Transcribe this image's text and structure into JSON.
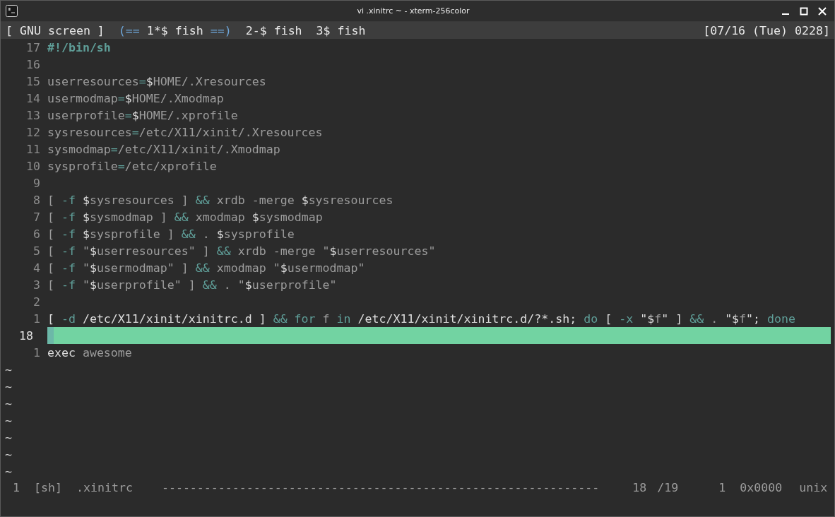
{
  "window": {
    "title": "vi .xinitrc ~ - xterm-256color"
  },
  "screen_bar": {
    "label": "[ GNU screen ]",
    "active_left": "(==",
    "active_right": "==)",
    "clock": "[07/16 (Tue) 0228]",
    "windows": [
      {
        "label": "1*$ fish",
        "selected": true
      },
      {
        "label": "2-$ fish",
        "selected": false
      },
      {
        "label": "3$ fish",
        "selected": false
      }
    ]
  },
  "editor": {
    "lines": [
      {
        "kind": "code",
        "number": "17",
        "current": false,
        "segments": [
          {
            "kind": "shebang",
            "text": "#!/bin/sh"
          }
        ]
      },
      {
        "kind": "code",
        "number": "16",
        "current": false
      },
      {
        "kind": "code",
        "number": "15",
        "current": false,
        "segments": [
          {
            "kind": "text",
            "text": "userresources"
          },
          {
            "kind": "op",
            "text": "="
          },
          {
            "kind": "bright",
            "text": "$"
          },
          {
            "kind": "text",
            "text": "HOME/.Xresources"
          }
        ]
      },
      {
        "kind": "code",
        "number": "14",
        "current": false,
        "segments": [
          {
            "kind": "text",
            "text": "usermodmap"
          },
          {
            "kind": "op",
            "text": "="
          },
          {
            "kind": "bright",
            "text": "$"
          },
          {
            "kind": "text",
            "text": "HOME/.Xmodmap"
          }
        ]
      },
      {
        "kind": "code",
        "number": "13",
        "current": false,
        "segments": [
          {
            "kind": "text",
            "text": "userprofile"
          },
          {
            "kind": "op",
            "text": "="
          },
          {
            "kind": "bright",
            "text": "$"
          },
          {
            "kind": "text",
            "text": "HOME/.xprofile"
          }
        ]
      },
      {
        "kind": "code",
        "number": "12",
        "current": false,
        "segments": [
          {
            "kind": "text",
            "text": "sysresources"
          },
          {
            "kind": "op",
            "text": "="
          },
          {
            "kind": "text",
            "text": "/etc/X11/xinit/.Xresources"
          }
        ]
      },
      {
        "kind": "code",
        "number": "11",
        "current": false,
        "segments": [
          {
            "kind": "text",
            "text": "sysmodmap"
          },
          {
            "kind": "op",
            "text": "="
          },
          {
            "kind": "text",
            "text": "/etc/X11/xinit/.Xmodmap"
          }
        ]
      },
      {
        "kind": "code",
        "number": "10",
        "current": false,
        "segments": [
          {
            "kind": "text",
            "text": "sysprofile"
          },
          {
            "kind": "op",
            "text": "="
          },
          {
            "kind": "text",
            "text": "/etc/xprofile"
          }
        ]
      },
      {
        "kind": "code",
        "number": "9",
        "current": false
      },
      {
        "kind": "code",
        "number": "8",
        "current": false,
        "segments": [
          {
            "kind": "text",
            "text": "[ "
          },
          {
            "kind": "op",
            "text": "-f "
          },
          {
            "kind": "bright",
            "text": "$"
          },
          {
            "kind": "text",
            "text": "sysresources ] "
          },
          {
            "kind": "op",
            "text": "&&"
          },
          {
            "kind": "text",
            "text": " xrdb -merge "
          },
          {
            "kind": "bright",
            "text": "$"
          },
          {
            "kind": "text",
            "text": "sysresources"
          }
        ]
      },
      {
        "kind": "code",
        "number": "7",
        "current": false,
        "segments": [
          {
            "kind": "text",
            "text": "[ "
          },
          {
            "kind": "op",
            "text": "-f "
          },
          {
            "kind": "bright",
            "text": "$"
          },
          {
            "kind": "text",
            "text": "sysmodmap ] "
          },
          {
            "kind": "op",
            "text": "&&"
          },
          {
            "kind": "text",
            "text": " xmodmap "
          },
          {
            "kind": "bright",
            "text": "$"
          },
          {
            "kind": "text",
            "text": "sysmodmap"
          }
        ]
      },
      {
        "kind": "code",
        "number": "6",
        "current": false,
        "segments": [
          {
            "kind": "text",
            "text": "[ "
          },
          {
            "kind": "op",
            "text": "-f "
          },
          {
            "kind": "bright",
            "text": "$"
          },
          {
            "kind": "text",
            "text": "sysprofile ] "
          },
          {
            "kind": "op",
            "text": "&&"
          },
          {
            "kind": "text",
            "text": " . "
          },
          {
            "kind": "bright",
            "text": "$"
          },
          {
            "kind": "text",
            "text": "sysprofile"
          }
        ]
      },
      {
        "kind": "code",
        "number": "5",
        "current": false,
        "segments": [
          {
            "kind": "text",
            "text": "[ "
          },
          {
            "kind": "op",
            "text": "-f"
          },
          {
            "kind": "text",
            "text": " \""
          },
          {
            "kind": "bright",
            "text": "$"
          },
          {
            "kind": "text",
            "text": "userresources\" ] "
          },
          {
            "kind": "op",
            "text": "&&"
          },
          {
            "kind": "text",
            "text": " xrdb -merge \""
          },
          {
            "kind": "bright",
            "text": "$"
          },
          {
            "kind": "text",
            "text": "userresources\""
          }
        ]
      },
      {
        "kind": "code",
        "number": "4",
        "current": false,
        "segments": [
          {
            "kind": "text",
            "text": "[ "
          },
          {
            "kind": "op",
            "text": "-f"
          },
          {
            "kind": "text",
            "text": " \""
          },
          {
            "kind": "bright",
            "text": "$"
          },
          {
            "kind": "text",
            "text": "usermodmap\" ] "
          },
          {
            "kind": "op",
            "text": "&&"
          },
          {
            "kind": "text",
            "text": " xmodmap \""
          },
          {
            "kind": "bright",
            "text": "$"
          },
          {
            "kind": "text",
            "text": "usermodmap\""
          }
        ]
      },
      {
        "kind": "code",
        "number": "3",
        "current": false,
        "segments": [
          {
            "kind": "text",
            "text": "[ "
          },
          {
            "kind": "op",
            "text": "-f"
          },
          {
            "kind": "text",
            "text": " \""
          },
          {
            "kind": "bright",
            "text": "$"
          },
          {
            "kind": "text",
            "text": "userprofile\" ] "
          },
          {
            "kind": "op",
            "text": "&&"
          },
          {
            "kind": "text",
            "text": " . \""
          },
          {
            "kind": "bright",
            "text": "$"
          },
          {
            "kind": "text",
            "text": "userprofile\""
          }
        ]
      },
      {
        "kind": "code",
        "number": "2",
        "current": false
      },
      {
        "kind": "code",
        "number": "1",
        "current": false,
        "segments": [
          {
            "kind": "bright",
            "text": "[ "
          },
          {
            "kind": "op",
            "text": "-d"
          },
          {
            "kind": "bright",
            "text": " /etc/X11/xinit/xinitrc.d ] "
          },
          {
            "kind": "op",
            "text": "&& for"
          },
          {
            "kind": "text",
            "text": " f "
          },
          {
            "kind": "op",
            "text": "in"
          },
          {
            "kind": "bright",
            "text": " /etc/X11/xinit/xinitrc.d/?*.sh; "
          },
          {
            "kind": "op",
            "text": "do"
          },
          {
            "kind": "bright",
            "text": " [ "
          },
          {
            "kind": "op",
            "text": "-x"
          },
          {
            "kind": "bright",
            "text": " \"$"
          },
          {
            "kind": "text",
            "text": "f"
          },
          {
            "kind": "bright",
            "text": "\" ] "
          },
          {
            "kind": "op",
            "text": "&&"
          },
          {
            "kind": "text",
            "text": " . "
          },
          {
            "kind": "bright",
            "text": "\"$"
          },
          {
            "kind": "text",
            "text": "f"
          },
          {
            "kind": "bright",
            "text": "\"; "
          },
          {
            "kind": "op",
            "text": "done"
          }
        ]
      },
      {
        "kind": "code",
        "number": "18",
        "current": true
      },
      {
        "kind": "code",
        "number": "1",
        "current": false,
        "segments": [
          {
            "kind": "bright",
            "text": "exec"
          },
          {
            "kind": "text",
            "text": " awesome"
          }
        ]
      },
      {
        "kind": "filler",
        "text": "~"
      },
      {
        "kind": "filler",
        "text": "~"
      },
      {
        "kind": "filler",
        "text": "~"
      },
      {
        "kind": "filler",
        "text": "~"
      },
      {
        "kind": "filler",
        "text": "~"
      },
      {
        "kind": "filler",
        "text": "~"
      },
      {
        "kind": "filler",
        "text": "~"
      }
    ]
  },
  "status_line": {
    "window_number": "1",
    "filetype": "[sh]",
    "filename": ".xinitrc",
    "rule": "--------------------------------------------------------------",
    "line": "18",
    "total": "/19",
    "column": "1",
    "char_code": "0x0000",
    "format": "unix"
  }
}
